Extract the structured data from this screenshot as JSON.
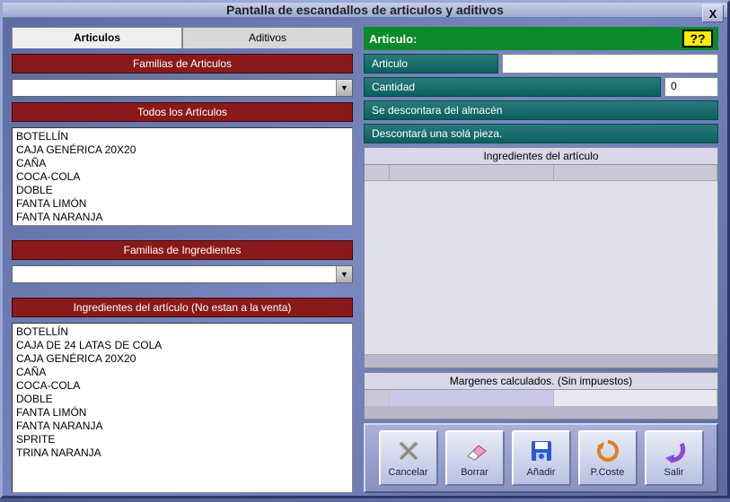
{
  "window": {
    "title": "Pantalla de escandallos de articulos y aditivos",
    "close": "X"
  },
  "tabs": {
    "articulos": "Articulos",
    "aditivos": "Aditivos"
  },
  "left": {
    "familias_articulos_hdr": "Familias de Articulos",
    "todos_articulos_hdr": "Todos los Artículos",
    "articulos": [
      "BOTELLÍN",
      "CAJA GENÉRICA 20X20",
      "CAÑA",
      "COCA-COLA",
      "DOBLE",
      "FANTA LIMÓN",
      "FANTA NARANJA"
    ],
    "familias_ingredientes_hdr": "Familias de Ingredientes",
    "ingredientes_hdr": "Ingredientes del artículo (No estan a la venta)",
    "ingredientes": [
      "BOTELLÍN",
      "CAJA DE 24 LATAS DE COLA",
      "CAJA GENÉRICA 20X20",
      "CAÑA",
      "COCA-COLA",
      "DOBLE",
      "FANTA LIMÓN",
      "FANTA NARANJA",
      "SPRITE",
      "TRINA NARANJA"
    ]
  },
  "right": {
    "articulo_hdr": "Articulo:",
    "help": "??",
    "lbl_articulo": "Articulo",
    "val_articulo": "",
    "lbl_cantidad": "Cantidad",
    "val_cantidad": "0",
    "lbl_descontara_almacen": "Se descontara del almacén",
    "lbl_descontara_pieza": "Descontará una solá pieza.",
    "grid_ingredientes_title": "Ingredientes del artículo",
    "grid_margenes_title": "Margenes calculados. (Sin impuestos)"
  },
  "actions": {
    "cancelar": "Cancelar",
    "borrar": "Borrar",
    "anadir": "Añadir",
    "pcoste": "P.Coste",
    "salir": "Salir"
  }
}
